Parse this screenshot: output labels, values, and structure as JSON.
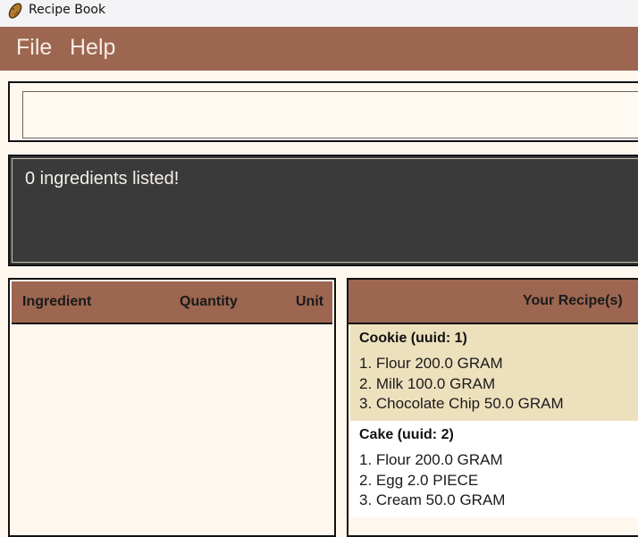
{
  "window": {
    "title": "Recipe Book",
    "icon": "potato-icon"
  },
  "menu": [
    {
      "label": "File"
    },
    {
      "label": "Help"
    }
  ],
  "command_box": {
    "value": "",
    "placeholder": ""
  },
  "result_display": {
    "text": "0 ingredients listed!"
  },
  "ingredient_panel": {
    "columns": [
      "Ingredient",
      "Quantity",
      "Unit"
    ],
    "rows": []
  },
  "recipe_panel": {
    "header": "Your Recipe(s)",
    "recipes": [
      {
        "title": "Cookie (uuid: 1)",
        "ingredients": [
          "1. Flour 200.0 GRAM",
          "2. Milk 100.0 GRAM",
          "3. Chocolate Chip 50.0 GRAM"
        ]
      },
      {
        "title": "Cake (uuid: 2)",
        "ingredients": [
          "1. Flour 200.0 GRAM",
          "2. Egg 2.0 PIECE",
          "3. Cream 50.0 GRAM"
        ]
      }
    ]
  },
  "colors": {
    "accent": "#9c6650",
    "background": "#fdf7ee",
    "result_bg": "#3a3a3a",
    "recipe_highlight": "#ede0bd"
  }
}
